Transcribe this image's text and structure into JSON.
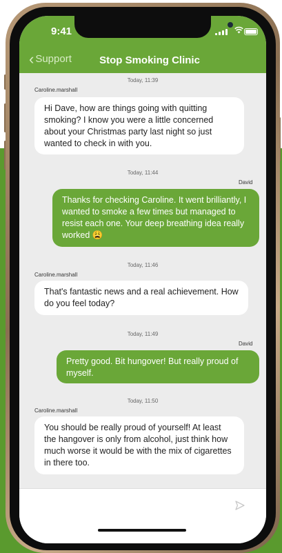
{
  "status": {
    "time": "9:41"
  },
  "nav": {
    "back_label": "Support",
    "title": "Stop Smoking Clinic"
  },
  "messages": [
    {
      "timestamp": "Today, 11:39",
      "sender": "Caroline.marshall",
      "text": "Hi Dave, how are things going with quitting smoking? I know you were a little concerned about your Christmas party last night so just wanted to check in with you."
    },
    {
      "timestamp": "Today, 11:44",
      "sender": "David",
      "text": "Thanks for checking Caroline. It went brilliantly, I wanted to smoke a few times but managed to resist each one. Your deep breathing idea really worked 😩"
    },
    {
      "timestamp": "Today, 11:46",
      "sender": "Caroline.marshall",
      "text": "That's fantastic news and a real achievement. How do you feel today?"
    },
    {
      "timestamp": "Today, 11:49",
      "sender": "David",
      "text": "Pretty good. Bit hungover! But really proud of myself."
    },
    {
      "timestamp": "Today, 11:50",
      "sender": "Caroline.marshall",
      "text": "You should be really proud of yourself! At least the hangover is only from alcohol, just think how much worse it would be with the mix of cigarettes in there too."
    }
  ],
  "input": {
    "placeholder": ""
  },
  "icons": {
    "back": "chevron-left-icon",
    "send": "send-icon",
    "signal": "signal-icon",
    "wifi": "wifi-icon",
    "battery": "battery-icon"
  },
  "colors": {
    "brand_green": "#6aa738",
    "background_green": "#5a9a2e",
    "chat_bg": "#ececec"
  }
}
